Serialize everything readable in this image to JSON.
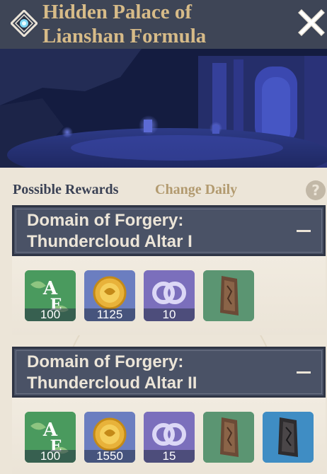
{
  "header": {
    "title_line1": "Hidden Palace of",
    "title_line2": "Lianshan Formula"
  },
  "rewards": {
    "possible_label": "Possible Rewards",
    "daily_label": "Change Daily",
    "help": "?"
  },
  "sections": [
    {
      "title_line1": "Domain of Forgery:",
      "title_line2": "Thundercloud Altar I",
      "items": [
        {
          "name": "adventure-exp",
          "icon": "adventure-exp-icon",
          "count": "100",
          "bg": "#4f9560"
        },
        {
          "name": "mora",
          "icon": "mora-coin-icon",
          "count": "1125",
          "bg": "#6a7fc0"
        },
        {
          "name": "companionship-exp",
          "icon": "friendship-icon",
          "count": "10",
          "bg": "#7a6fbb"
        },
        {
          "name": "enhancement-ore",
          "icon": "ore-icon",
          "count": "",
          "bg": "#5a9470"
        }
      ]
    },
    {
      "title_line1": "Domain of Forgery:",
      "title_line2": "Thundercloud Altar II",
      "items": [
        {
          "name": "adventure-exp",
          "icon": "adventure-exp-icon",
          "count": "100",
          "bg": "#4f9560"
        },
        {
          "name": "mora",
          "icon": "mora-coin-icon",
          "count": "1550",
          "bg": "#6a7fc0"
        },
        {
          "name": "companionship-exp",
          "icon": "friendship-icon",
          "count": "15",
          "bg": "#7a6fbb"
        },
        {
          "name": "enhancement-ore",
          "icon": "ore-icon",
          "count": "",
          "bg": "#5a9470"
        },
        {
          "name": "fine-enhancement-ore",
          "icon": "dark-ore-icon",
          "count": "",
          "bg": "#3e8ec4"
        }
      ]
    }
  ]
}
